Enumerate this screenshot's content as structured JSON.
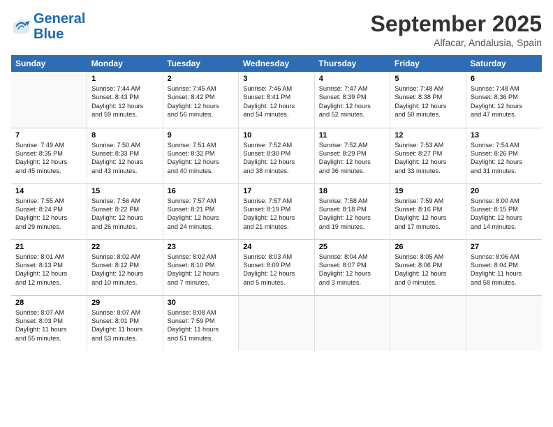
{
  "header": {
    "logo_general": "General",
    "logo_blue": "Blue",
    "month_title": "September 2025",
    "location": "Alfacar, Andalusia, Spain"
  },
  "weekdays": [
    "Sunday",
    "Monday",
    "Tuesday",
    "Wednesday",
    "Thursday",
    "Friday",
    "Saturday"
  ],
  "weeks": [
    [
      {
        "day": "",
        "info": ""
      },
      {
        "day": "1",
        "info": "Sunrise: 7:44 AM\nSunset: 8:43 PM\nDaylight: 12 hours\nand 59 minutes."
      },
      {
        "day": "2",
        "info": "Sunrise: 7:45 AM\nSunset: 8:42 PM\nDaylight: 12 hours\nand 56 minutes."
      },
      {
        "day": "3",
        "info": "Sunrise: 7:46 AM\nSunset: 8:41 PM\nDaylight: 12 hours\nand 54 minutes."
      },
      {
        "day": "4",
        "info": "Sunrise: 7:47 AM\nSunset: 8:39 PM\nDaylight: 12 hours\nand 52 minutes."
      },
      {
        "day": "5",
        "info": "Sunrise: 7:48 AM\nSunset: 8:38 PM\nDaylight: 12 hours\nand 50 minutes."
      },
      {
        "day": "6",
        "info": "Sunrise: 7:48 AM\nSunset: 8:36 PM\nDaylight: 12 hours\nand 47 minutes."
      }
    ],
    [
      {
        "day": "7",
        "info": "Sunrise: 7:49 AM\nSunset: 8:35 PM\nDaylight: 12 hours\nand 45 minutes."
      },
      {
        "day": "8",
        "info": "Sunrise: 7:50 AM\nSunset: 8:33 PM\nDaylight: 12 hours\nand 43 minutes."
      },
      {
        "day": "9",
        "info": "Sunrise: 7:51 AM\nSunset: 8:32 PM\nDaylight: 12 hours\nand 40 minutes."
      },
      {
        "day": "10",
        "info": "Sunrise: 7:52 AM\nSunset: 8:30 PM\nDaylight: 12 hours\nand 38 minutes."
      },
      {
        "day": "11",
        "info": "Sunrise: 7:52 AM\nSunset: 8:29 PM\nDaylight: 12 hours\nand 36 minutes."
      },
      {
        "day": "12",
        "info": "Sunrise: 7:53 AM\nSunset: 8:27 PM\nDaylight: 12 hours\nand 33 minutes."
      },
      {
        "day": "13",
        "info": "Sunrise: 7:54 AM\nSunset: 8:26 PM\nDaylight: 12 hours\nand 31 minutes."
      }
    ],
    [
      {
        "day": "14",
        "info": "Sunrise: 7:55 AM\nSunset: 8:24 PM\nDaylight: 12 hours\nand 29 minutes."
      },
      {
        "day": "15",
        "info": "Sunrise: 7:56 AM\nSunset: 8:22 PM\nDaylight: 12 hours\nand 26 minutes."
      },
      {
        "day": "16",
        "info": "Sunrise: 7:57 AM\nSunset: 8:21 PM\nDaylight: 12 hours\nand 24 minutes."
      },
      {
        "day": "17",
        "info": "Sunrise: 7:57 AM\nSunset: 8:19 PM\nDaylight: 12 hours\nand 21 minutes."
      },
      {
        "day": "18",
        "info": "Sunrise: 7:58 AM\nSunset: 8:18 PM\nDaylight: 12 hours\nand 19 minutes."
      },
      {
        "day": "19",
        "info": "Sunrise: 7:59 AM\nSunset: 8:16 PM\nDaylight: 12 hours\nand 17 minutes."
      },
      {
        "day": "20",
        "info": "Sunrise: 8:00 AM\nSunset: 8:15 PM\nDaylight: 12 hours\nand 14 minutes."
      }
    ],
    [
      {
        "day": "21",
        "info": "Sunrise: 8:01 AM\nSunset: 8:13 PM\nDaylight: 12 hours\nand 12 minutes."
      },
      {
        "day": "22",
        "info": "Sunrise: 8:02 AM\nSunset: 8:12 PM\nDaylight: 12 hours\nand 10 minutes."
      },
      {
        "day": "23",
        "info": "Sunrise: 8:02 AM\nSunset: 8:10 PM\nDaylight: 12 hours\nand 7 minutes."
      },
      {
        "day": "24",
        "info": "Sunrise: 8:03 AM\nSunset: 8:09 PM\nDaylight: 12 hours\nand 5 minutes."
      },
      {
        "day": "25",
        "info": "Sunrise: 8:04 AM\nSunset: 8:07 PM\nDaylight: 12 hours\nand 3 minutes."
      },
      {
        "day": "26",
        "info": "Sunrise: 8:05 AM\nSunset: 8:06 PM\nDaylight: 12 hours\nand 0 minutes."
      },
      {
        "day": "27",
        "info": "Sunrise: 8:06 AM\nSunset: 8:04 PM\nDaylight: 11 hours\nand 58 minutes."
      }
    ],
    [
      {
        "day": "28",
        "info": "Sunrise: 8:07 AM\nSunset: 8:03 PM\nDaylight: 11 hours\nand 55 minutes."
      },
      {
        "day": "29",
        "info": "Sunrise: 8:07 AM\nSunset: 8:01 PM\nDaylight: 11 hours\nand 53 minutes."
      },
      {
        "day": "30",
        "info": "Sunrise: 8:08 AM\nSunset: 7:59 PM\nDaylight: 11 hours\nand 51 minutes."
      },
      {
        "day": "",
        "info": ""
      },
      {
        "day": "",
        "info": ""
      },
      {
        "day": "",
        "info": ""
      },
      {
        "day": "",
        "info": ""
      }
    ]
  ]
}
